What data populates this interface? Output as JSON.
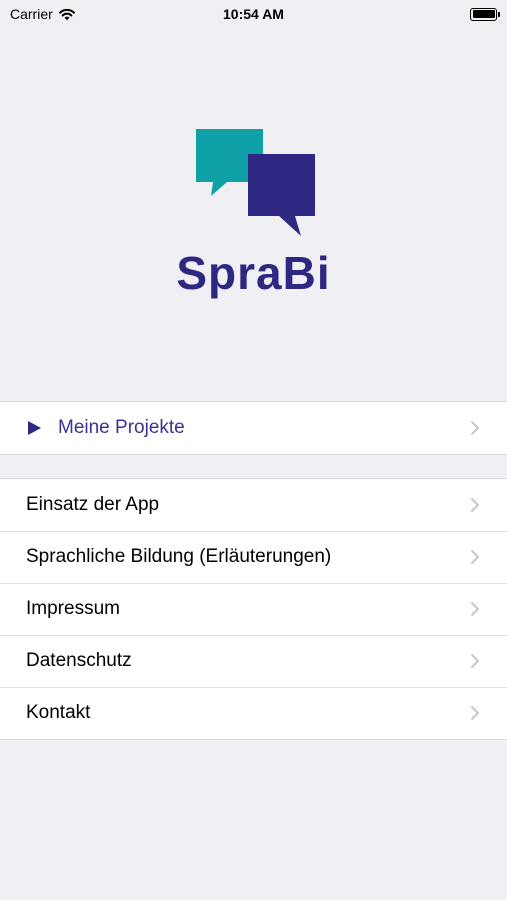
{
  "status_bar": {
    "carrier": "Carrier",
    "time": "10:54 AM",
    "wifi_icon": "wifi-icon",
    "battery_icon": "battery-icon"
  },
  "logo": {
    "text": "SpraBi",
    "colors": {
      "teal_bubble": "#0fa0a8",
      "indigo_bubble": "#2e2883",
      "text": "#2e2883"
    }
  },
  "menu_primary": {
    "items": [
      {
        "label": "Meine Projekte",
        "icon": "play-icon"
      }
    ]
  },
  "menu_secondary": {
    "items": [
      {
        "label": "Einsatz der App"
      },
      {
        "label": "Sprachliche Bildung (Erläuterungen)"
      },
      {
        "label": "Impressum"
      },
      {
        "label": "Datenschutz"
      },
      {
        "label": "Kontakt"
      }
    ]
  },
  "colors": {
    "background": "#efeff4",
    "accent": "#3a3392",
    "chevron": "#c7c7cc"
  }
}
